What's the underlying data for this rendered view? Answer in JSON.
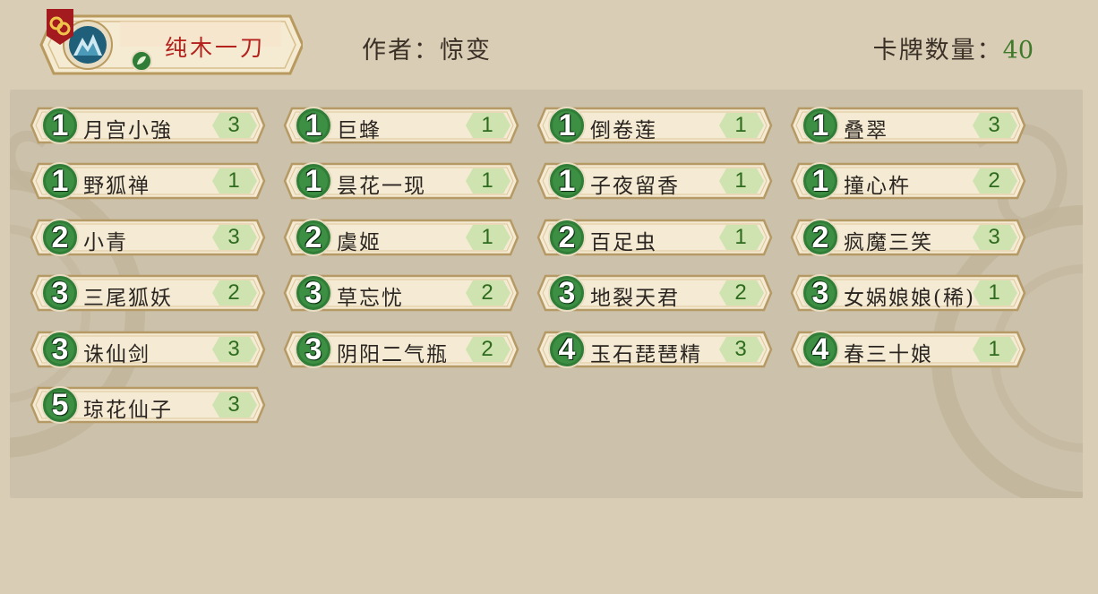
{
  "deck": {
    "name": "纯木一刀",
    "author_label": "作者：",
    "author": "惊变",
    "count_label": "卡牌数量：",
    "count": "40"
  },
  "cards": [
    {
      "cost": "1",
      "name": "月宫小強",
      "qty": "3"
    },
    {
      "cost": "1",
      "name": "巨蜂",
      "qty": "1"
    },
    {
      "cost": "1",
      "name": "倒卷莲",
      "qty": "1"
    },
    {
      "cost": "1",
      "name": "叠翠",
      "qty": "3"
    },
    {
      "cost": "1",
      "name": "野狐禅",
      "qty": "1"
    },
    {
      "cost": "1",
      "name": "昙花一现",
      "qty": "1"
    },
    {
      "cost": "1",
      "name": "子夜留香",
      "qty": "1"
    },
    {
      "cost": "1",
      "name": "撞心杵",
      "qty": "2"
    },
    {
      "cost": "2",
      "name": "小青",
      "qty": "3"
    },
    {
      "cost": "2",
      "name": "虞姬",
      "qty": "1"
    },
    {
      "cost": "2",
      "name": "百足虫",
      "qty": "1"
    },
    {
      "cost": "2",
      "name": "疯魔三笑",
      "qty": "3"
    },
    {
      "cost": "3",
      "name": "三尾狐妖",
      "qty": "2"
    },
    {
      "cost": "3",
      "name": "草忘忧",
      "qty": "2"
    },
    {
      "cost": "3",
      "name": "地裂天君",
      "qty": "2"
    },
    {
      "cost": "3",
      "name": "女娲娘娘(稀)",
      "qty": "1"
    },
    {
      "cost": "3",
      "name": "诛仙剑",
      "qty": "3"
    },
    {
      "cost": "3",
      "name": "阴阳二气瓶",
      "qty": "2"
    },
    {
      "cost": "4",
      "name": "玉石琵琶精",
      "qty": "3"
    },
    {
      "cost": "4",
      "name": "春三十娘",
      "qty": "1"
    },
    {
      "cost": "5",
      "name": "琼花仙子",
      "qty": "3"
    }
  ],
  "colors": {
    "background": "#d9cdb5",
    "panel": "#ccc1aa",
    "cost_gem": "#2f7d36",
    "qty_badge": "#cfe3b0",
    "deck_name": "#b3221c"
  },
  "icons": {
    "link": "link-icon",
    "avatar": "mountain-avatar-icon",
    "faction": "leaf-faction-icon"
  }
}
